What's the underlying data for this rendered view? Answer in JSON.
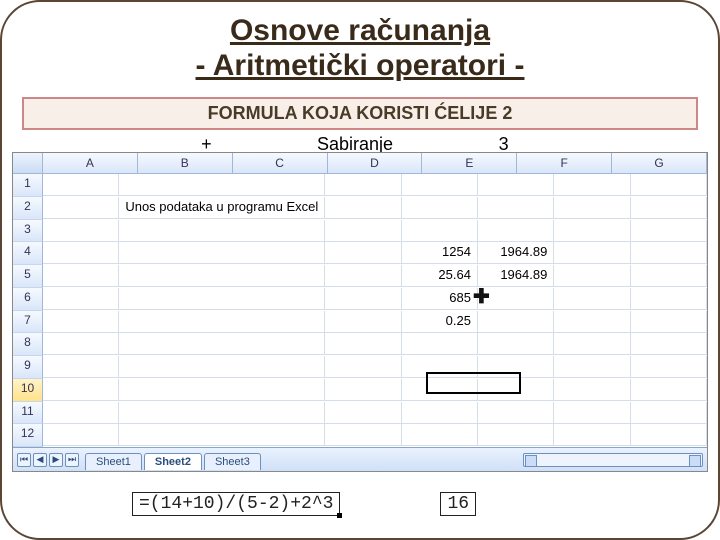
{
  "title_line1": "Osnove računanja",
  "title_line2": "- Aritmetički operatori -",
  "subheading": "FORMULA KOJA KORISTI ĆELIJE 2",
  "op_row": {
    "symbol": "+",
    "name": "Sabiranje",
    "priority": "3"
  },
  "excel": {
    "columns": [
      "A",
      "B",
      "C",
      "D",
      "E",
      "F",
      "G"
    ],
    "rows": [
      "1",
      "2",
      "3",
      "4",
      "5",
      "6",
      "7",
      "8",
      "9",
      "10",
      "11",
      "12"
    ],
    "active_row": "10",
    "b2": "Unos podataka u programu Excel",
    "d4": "1254",
    "e4": "1964.89",
    "d5": "25.64",
    "e5": "1964.89",
    "d6": "685",
    "d7": "0.25",
    "sheets": [
      "Sheet1",
      "Sheet2",
      "Sheet3"
    ],
    "active_sheet": "Sheet2"
  },
  "bottom_formula": "=(14+10)/(5-2)+2^3",
  "bottom_result": "16"
}
